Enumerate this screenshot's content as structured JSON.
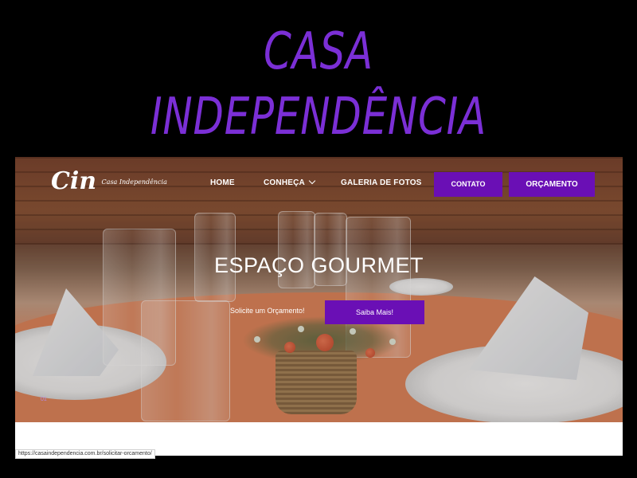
{
  "banner": {
    "line1": "CASA",
    "line2": "INDEPENDÊNCIA",
    "color": "#7b2fd6"
  },
  "site": {
    "logo": {
      "mark": "Cin",
      "subtitle": "Casa Independência"
    },
    "nav": {
      "home": "HOME",
      "conheca": "CONHEÇA",
      "galeria": "GALERIA DE FOTOS",
      "contato": "CONTATO",
      "orcamento": "ORÇAMENTO"
    },
    "hero": {
      "title": "ESPAÇO GOURMET",
      "link": "Solicite um Orçamento!",
      "button": "Saiba Mais!",
      "slide_number": "01"
    },
    "accent": "#6a0fb5"
  },
  "status_bar": {
    "url": "https://casaindependencia.com.br/solicitar-orcamento/"
  },
  "icons": [
    "chevron-down-icon"
  ]
}
